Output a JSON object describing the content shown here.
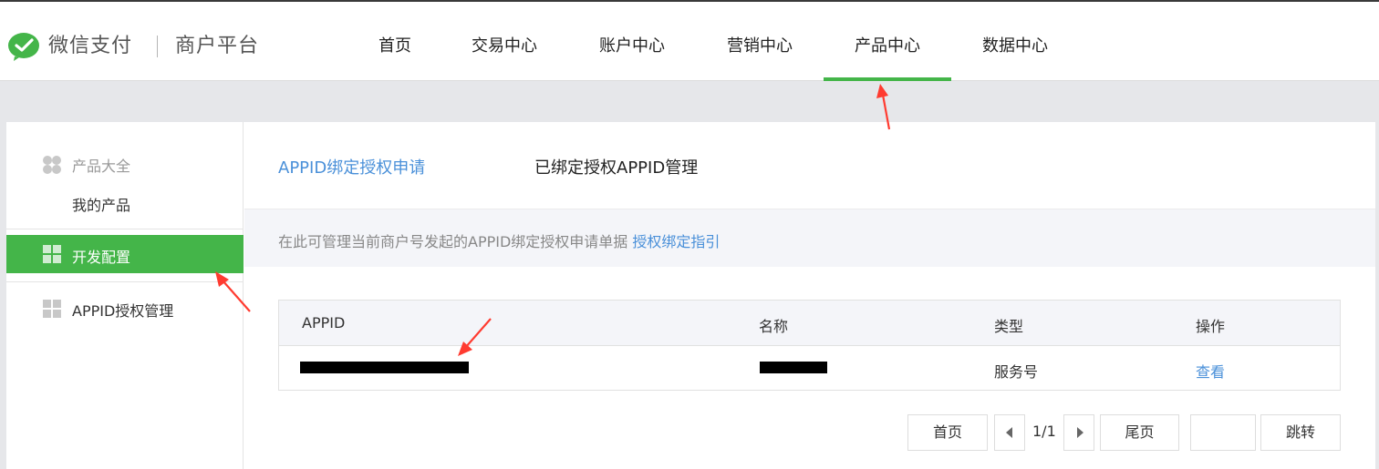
{
  "header": {
    "brand": "微信支付",
    "platform": "商户平台",
    "nav": [
      {
        "label": "首页",
        "active": false
      },
      {
        "label": "交易中心",
        "active": false
      },
      {
        "label": "账户中心",
        "active": false
      },
      {
        "label": "营销中心",
        "active": false
      },
      {
        "label": "产品中心",
        "active": true
      },
      {
        "label": "数据中心",
        "active": false
      }
    ]
  },
  "colors": {
    "accent": "#44b549",
    "link": "#4a90d9",
    "annotation": "#ff3b30"
  },
  "sidebar": {
    "group_title": "产品大全",
    "group_sub": "我的产品",
    "active_item": "开发配置",
    "item": "APPID授权管理"
  },
  "main": {
    "tabs": [
      {
        "label": "APPID绑定授权申请",
        "active": true
      },
      {
        "label": "已绑定授权APPID管理",
        "active": false
      }
    ],
    "notice": {
      "text": "在此可管理当前商户号发起的APPID绑定授权申请单据 ",
      "link": "授权绑定指引"
    },
    "table": {
      "columns": [
        "APPID",
        "名称",
        "类型",
        "操作"
      ],
      "rows": [
        {
          "appid": "",
          "name": "",
          "type": "服务号",
          "action": "查看"
        }
      ]
    },
    "pagination": {
      "first": "首页",
      "page": "1/1",
      "last": "尾页",
      "jump_value": "",
      "jump": "跳转"
    }
  }
}
